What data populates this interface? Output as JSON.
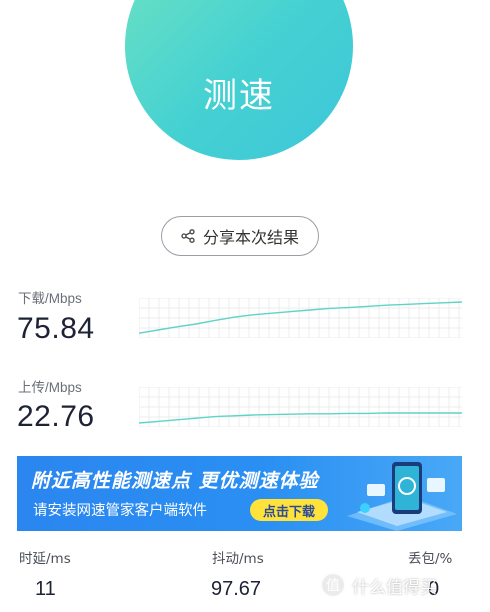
{
  "speed_button": {
    "label": "测速"
  },
  "share_button": {
    "label": "分享本次结果",
    "icon": "share-icon"
  },
  "download": {
    "label": "下载/Mbps",
    "value": "75.84",
    "level": [
      0.12,
      0.2,
      0.28,
      0.35,
      0.44,
      0.52,
      0.58,
      0.62,
      0.66,
      0.7,
      0.74,
      0.76,
      0.79,
      0.82,
      0.84,
      0.86,
      0.88,
      0.9
    ],
    "color": "#5fd3c5"
  },
  "upload": {
    "label": "上传/Mbps",
    "value": "22.76",
    "level": [
      0.1,
      0.14,
      0.18,
      0.22,
      0.26,
      0.28,
      0.3,
      0.31,
      0.32,
      0.33,
      0.33,
      0.34,
      0.34,
      0.35,
      0.35,
      0.35,
      0.35,
      0.35
    ],
    "color": "#5fd3c5"
  },
  "banner": {
    "headline": "附近高性能测速点  更优测速体验",
    "subline": "请安装网速管家客户端软件",
    "button": "点击下载",
    "background": "#2b86f0",
    "button_color": "#ffe23a"
  },
  "stats": [
    {
      "label": "时延/ms",
      "value": "11"
    },
    {
      "label": "抖动/ms",
      "value": "97.67"
    },
    {
      "label": "丢包/%",
      "value": "0"
    }
  ],
  "watermark": {
    "text": "什么值得买",
    "icon": "zhi"
  },
  "colors": {
    "accent": "#45d1d2",
    "text": "#1e2235",
    "label": "#6b6f78"
  }
}
